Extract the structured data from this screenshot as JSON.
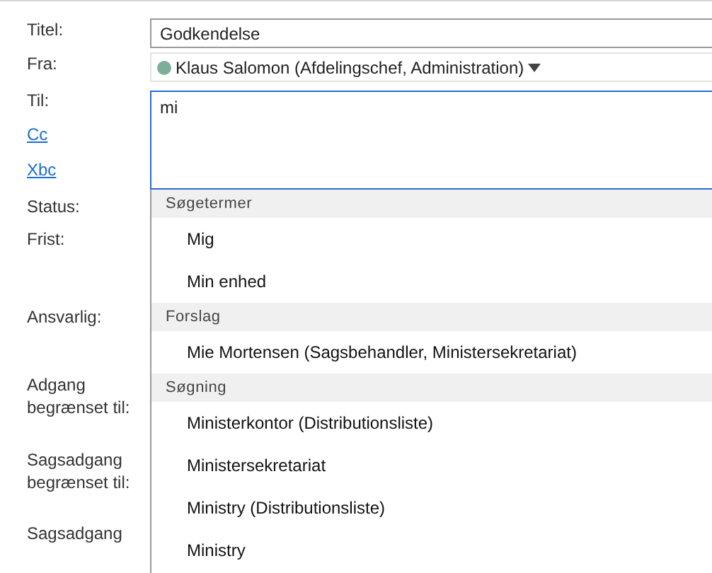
{
  "labels": [
    {
      "text": "Titel:",
      "kind": "label"
    },
    {
      "text": "Fra:",
      "kind": "label"
    },
    {
      "text": "Til:",
      "kind": "label"
    },
    {
      "text": "Cc",
      "kind": "link"
    },
    {
      "text": "Xbc",
      "kind": "link"
    },
    {
      "text": "Status:",
      "kind": "label"
    },
    {
      "text": "Frist:",
      "kind": "label"
    },
    {
      "text": "Ansvarlig:",
      "kind": "label"
    },
    {
      "text": "Adgang begrænset til:",
      "kind": "label"
    },
    {
      "text": "Sagsadgang begrænset til:",
      "kind": "label"
    },
    {
      "text": "Sagsadgang",
      "kind": "label"
    }
  ],
  "title_field": {
    "value": "Godkendelse"
  },
  "from_field": {
    "value": "Klaus Salomon (Afdelingschef, Administration)"
  },
  "to_field": {
    "value": "mi"
  },
  "suggestions": [
    {
      "kind": "header",
      "text": "Søgetermer"
    },
    {
      "kind": "item",
      "text": "Mig"
    },
    {
      "kind": "item",
      "text": "Min enhed"
    },
    {
      "kind": "header",
      "text": "Forslag"
    },
    {
      "kind": "item",
      "text": "Mie Mortensen (Sagsbehandler, Ministersekretariat)"
    },
    {
      "kind": "header",
      "text": "Søgning"
    },
    {
      "kind": "item",
      "text": "Ministerkontor (Distributionsliste)"
    },
    {
      "kind": "item",
      "text": "Ministersekretariat"
    },
    {
      "kind": "item",
      "text": "Ministry (Distributionsliste)"
    },
    {
      "kind": "item",
      "text": "Ministry"
    }
  ]
}
